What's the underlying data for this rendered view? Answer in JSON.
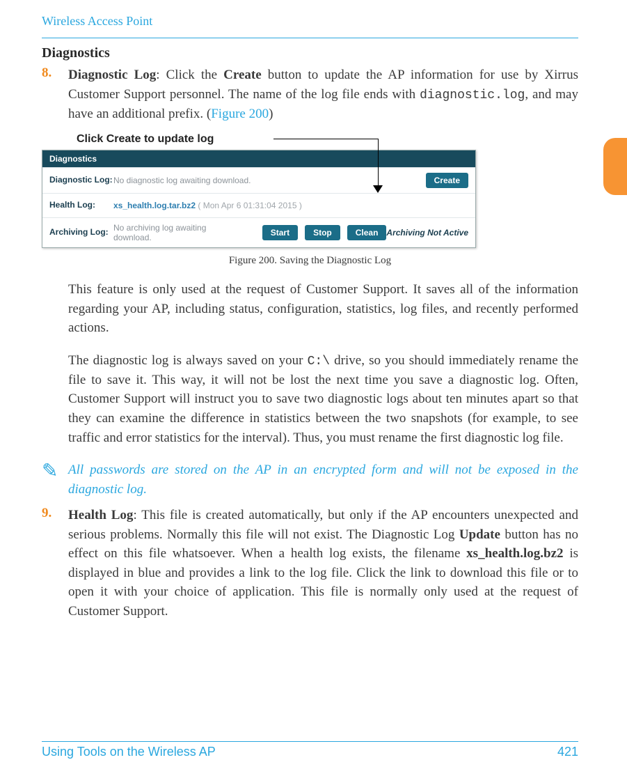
{
  "header": {
    "title": "Wireless Access Point"
  },
  "section": {
    "title": "Diagnostics"
  },
  "item8": {
    "num": "8.",
    "label_bold1": "Diagnostic Log",
    "sep1": ": Click the ",
    "label_bold2": "Create",
    "tail1": " button to update the AP information for use by Xirrus Customer Support personnel. The name of the log file ends with ",
    "mono1": "diagnostic.log",
    "tail2": ", and may have an additional prefix. (",
    "link1": "Figure 200",
    "tail3": ")"
  },
  "callout": {
    "label": "Click Create to update log"
  },
  "screenshot": {
    "title": "Diagnostics",
    "row1": {
      "label": "Diagnostic Log:",
      "text": "No diagnostic log awaiting download.",
      "button": "Create"
    },
    "row2": {
      "label": "Health Log:",
      "file": "xs_health.log.tar.bz2",
      "stamp": "( Mon Apr 6 01:31:04 2015 )"
    },
    "row3": {
      "label": "Archiving Log:",
      "text": "No archiving log awaiting download.",
      "b1": "Start",
      "b2": "Stop",
      "b3": "Clean",
      "status": "Archiving Not Active"
    }
  },
  "figcaption": "Figure 200. Saving the Diagnostic Log",
  "para1": {
    "t": "This feature is only used at the request of Customer Support. It saves all of the information regarding your AP, including status, configuration, statistics, log files, and recently performed actions."
  },
  "para2": {
    "pre": "The diagnostic log is always saved on your ",
    "mono": "C:\\",
    "post": " drive, so you should immediately rename the file to save it. This way, it will not be lost the next time you save a diagnostic log. Often, Customer Support will instruct you to save two diagnostic logs about ten minutes apart so that they can examine the difference in statistics between the two snapshots (for example, to see traffic and error statistics for the interval). Thus, you must rename the first diagnostic log file."
  },
  "note": {
    "icon": "✎",
    "text": "All passwords are stored on the AP in an encrypted form and will not be exposed in the diagnostic log."
  },
  "item9": {
    "num": "9.",
    "b1": "Health Log",
    "t1": ": This file is created automatically, but only if the AP encounters unexpected and serious problems. Normally this file will not exist. The Diagnostic Log ",
    "b2": "Update",
    "t2": " button has no effect on this file whatsoever. When a health log exists, the filename ",
    "b3": "xs_health.log.bz2",
    "t3": " is displayed in blue and provides a link to the log file. Click the link to download this file or to open it with your choice of application. This file is normally only used at the request of Customer Support."
  },
  "footer": {
    "left": "Using Tools on the Wireless AP",
    "right": "421"
  }
}
